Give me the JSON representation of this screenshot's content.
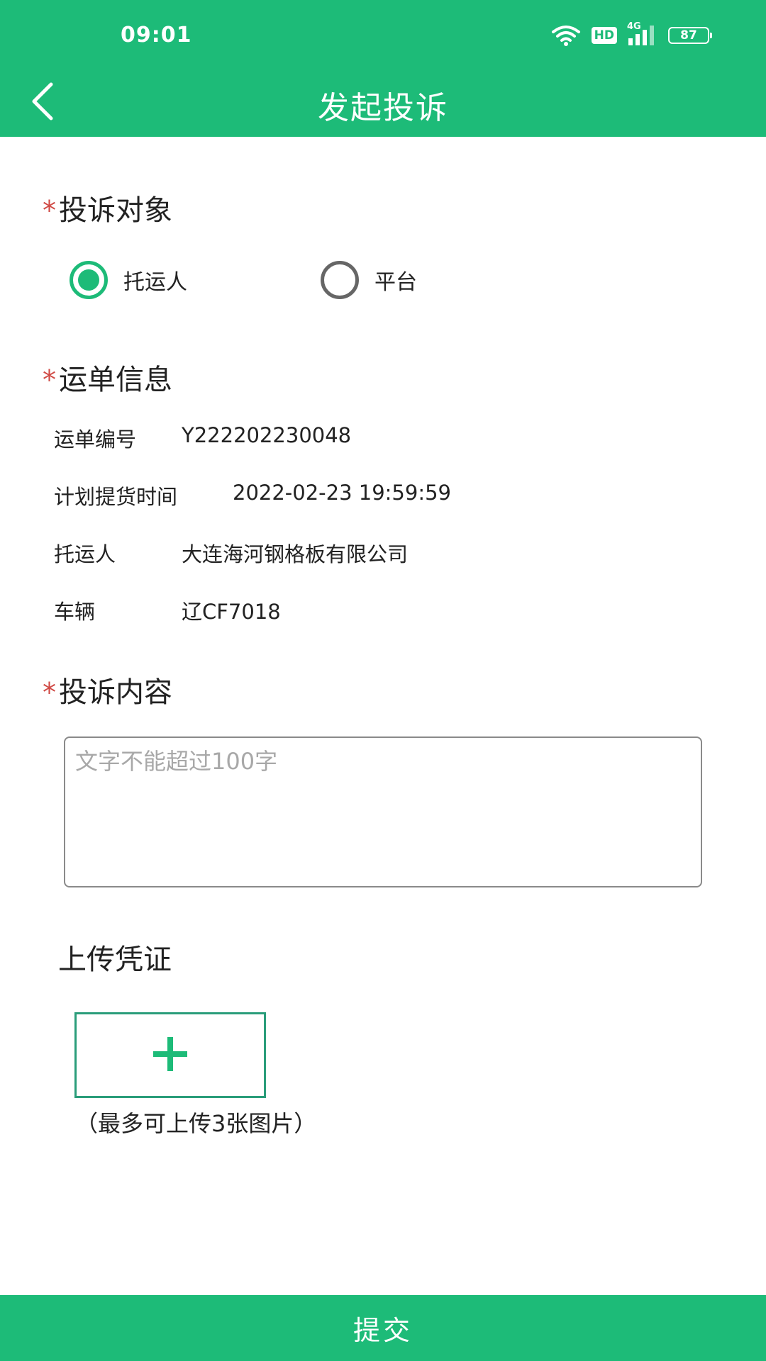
{
  "status_bar": {
    "time": "09:01",
    "hd_label": "HD",
    "network_label": "4G",
    "battery_level": "87"
  },
  "header": {
    "title": "发起投诉",
    "back_icon": "chevron-left-icon"
  },
  "complaint_target": {
    "required_mark": "*",
    "title": "投诉对象",
    "options": [
      {
        "label": "托运人",
        "checked": true
      },
      {
        "label": "平台",
        "checked": false
      }
    ]
  },
  "waybill": {
    "required_mark": "*",
    "title": "运单信息",
    "rows": [
      {
        "key": "运单编号",
        "value": "Y222202230048"
      },
      {
        "key": "计划提货时间",
        "value": "2022-02-23 19:59:59"
      },
      {
        "key": "托运人",
        "value": "大连海河钢格板有限公司"
      },
      {
        "key": "车辆",
        "value": "辽CF7018"
      }
    ]
  },
  "complaint_content": {
    "required_mark": "*",
    "title": "投诉内容",
    "value": "",
    "placeholder": "文字不能超过100字"
  },
  "upload": {
    "title": "上传凭证",
    "add_icon": "plus-icon",
    "hint": "（最多可上传3张图片）"
  },
  "submit": {
    "label": "提交"
  },
  "colors": {
    "primary": "#1dbb78",
    "required": "#d04a45",
    "upload_border": "#2a9d7a"
  }
}
